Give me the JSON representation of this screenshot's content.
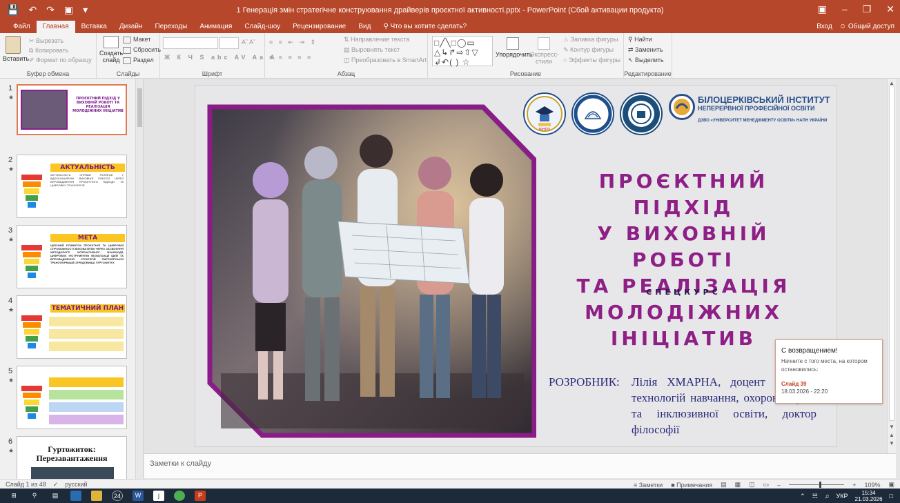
{
  "app": {
    "title": "1 Генерація змін стратегічне конструювання драйверів проєктної активності.pptx - PowerPoint (Сбой активации продукта)"
  },
  "tabs": [
    "Файл",
    "Главная",
    "Вставка",
    "Дизайн",
    "Переходы",
    "Анимация",
    "Слайд-шоу",
    "Рецензирование",
    "Вид"
  ],
  "active_tab": "Главная",
  "tell_me": "Что вы хотите сделать?",
  "account": {
    "signin": "Вход",
    "share": "Общий доступ"
  },
  "ribbon": {
    "clipboard": {
      "paste": "Вставить",
      "cut": "Вырезать",
      "copy": "Копировать",
      "format_painter": "Формат по образцу",
      "group": "Буфер обмена"
    },
    "slides": {
      "new_slide_l1": "Создать",
      "new_slide_l2": "слайд",
      "layout": "Макет",
      "reset": "Сбросить",
      "section": "Раздел",
      "group": "Слайды"
    },
    "font": {
      "group": "Шрифт"
    },
    "paragraph": {
      "text_direction": "Направление текста",
      "align_text": "Выровнять текст",
      "smartart": "Преобразовать в SmartArt",
      "group": "Абзац"
    },
    "drawing": {
      "arrange": "Упорядочить",
      "quick_styles_l1": "Экспресс-",
      "quick_styles_l2": "стили",
      "fill": "Заливка фигуры",
      "outline": "Контур фигуры",
      "effects": "Эффекты фигуры",
      "group": "Рисование"
    },
    "editing": {
      "find": "Найти",
      "replace": "Заменить",
      "select": "Выделить",
      "group": "Редактирование"
    }
  },
  "thumbnails": [
    {
      "num": "1",
      "title": "ПРОЄКТНИЙ ПІДХІД У ВИХОВНІЙ РОБОТІ ТА РЕАЛІЗАЦІЯ МОЛОДІЖНИХ ІНІЦІАТИВ",
      "selected": true
    },
    {
      "num": "2",
      "title": "АКТУАЛЬНІСТЬ",
      "text": "АКТУАЛЬНІСТЬ СПРАВИ ПОЛЯГАЄ У ВДОСКОНАЛЕННІ ВИХОВНОЇ РОБОТИ ЧЕРЕЗ ВПРОВАДЖЕННЯ ПРОЄКТНОГО ПІДХОДУ ТА ЦИФРОВИХ ТЕХНОЛОГІЙ"
    },
    {
      "num": "3",
      "title": "МЕТА",
      "text": "ЦІЛІСНИЙ РОЗВИТОК ПРОЄКТНОЇ ТА ЦИФРОВОЇ СПРОМОЖНОСТІ ВИХОВАТЕЛІВ ЧЕРЕЗ ЗАСВОЄННЯ МЕТОДОЛОГІЇ ІНТЕРАКТИВНОЇ ВЗАЄМОДІЇ, ЦИФРОВИХ ІНСТРУМЕНТІВ ВІЗУАЛІЗАЦІЇ ІДЕЙ ТА ВПРОВАДЖЕННЯ СТРАТЕГІЙ ПАРТНЕРСЬКОЇ ТРАНСФОРМАЦІЇ СЕРЕДОВИЩА ГУРТОЖИТКУ."
    },
    {
      "num": "4",
      "title": "ТЕМАТИЧНИЙ ПЛАН"
    },
    {
      "num": "5",
      "title": ""
    },
    {
      "num": "6",
      "title": "Гуртожиток: Перезавантаження"
    }
  ],
  "slide": {
    "institute_l1": "БІЛОЦЕРКІВСЬКИЙ ІНСТИТУТ",
    "institute_l2": "НЕПЕРЕРВНОЇ ПРОФЕСІЙНОЇ ОСВІТИ",
    "institute_l3": "ДЗВО «УНІВЕРСИТЕТ МЕНЕДЖМЕНТУ ОСВІТИ» НАПН УКРАЇНИ",
    "logo1": "БІНПО",
    "title_lines": [
      "ПРОЄКТНИЙ ПІДХІД",
      "У ВИХОВНІЙ РОБОТІ",
      "ТА РЕАЛІЗАЦІЯ",
      "МОЛОДІЖНИХ",
      "ІНІЦІАТИВ"
    ],
    "subtitle": "СПЕЦКУРС",
    "author_label": "РОЗРОБНИК:",
    "author_text": "Лілія ХМАРНА, доцент кафедри технологій навчання, охорони праці та інклюзивної освіти, доктор філософії"
  },
  "notes_placeholder": "Заметки к слайду",
  "popup": {
    "heading": "С возвращением!",
    "text": "Начните с того места, на котором остановились:",
    "slide": "Слайд 39",
    "date": "18.03.2026 - 22:20"
  },
  "status": {
    "slide_info": "Слайд 1 из 48",
    "language": "русский",
    "notes": "Заметки",
    "comments": "Примечания",
    "zoom": "109%"
  },
  "taskbar": {
    "badge": "24",
    "lang": "УКР",
    "time": "15:34",
    "date": "21.03.2026"
  },
  "colors": {
    "accent": "#b7472a",
    "title_purple": "#8e1f86",
    "frame_purple": "#8a1c88"
  }
}
